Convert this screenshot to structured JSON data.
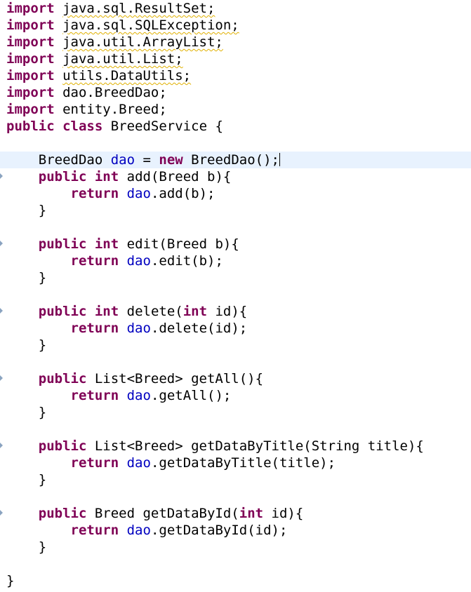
{
  "editor": {
    "language": "java",
    "current_line": 10,
    "lines": [
      {
        "tokens": [
          {
            "t": "import",
            "k": "kw"
          },
          {
            "t": " "
          },
          {
            "t": "java.sql.ResultSet;",
            "sq": true
          }
        ]
      },
      {
        "tokens": [
          {
            "t": "import",
            "k": "kw"
          },
          {
            "t": " "
          },
          {
            "t": "java.sql.SQLException;",
            "sq": true
          }
        ]
      },
      {
        "tokens": [
          {
            "t": "import",
            "k": "kw"
          },
          {
            "t": " "
          },
          {
            "t": "java.util.ArrayList;",
            "sq": true
          }
        ]
      },
      {
        "tokens": [
          {
            "t": "import",
            "k": "kw"
          },
          {
            "t": " "
          },
          {
            "t": "java.util.List;",
            "sq": true
          }
        ]
      },
      {
        "tokens": [
          {
            "t": "import",
            "k": "kw"
          },
          {
            "t": " "
          },
          {
            "t": "utils.DataUtils;",
            "sq": true
          }
        ]
      },
      {
        "tokens": [
          {
            "t": "import",
            "k": "kw"
          },
          {
            "t": " dao.BreedDao;"
          }
        ]
      },
      {
        "tokens": [
          {
            "t": "import",
            "k": "kw"
          },
          {
            "t": " entity.Breed;"
          }
        ]
      },
      {
        "tokens": [
          {
            "t": "public",
            "k": "kw"
          },
          {
            "t": " "
          },
          {
            "t": "class",
            "k": "kw"
          },
          {
            "t": " BreedService {"
          }
        ]
      },
      {
        "tokens": []
      },
      {
        "tokens": [
          {
            "t": "    BreedDao "
          },
          {
            "t": "dao",
            "k": "fld"
          },
          {
            "t": " = "
          },
          {
            "t": "new",
            "k": "kw"
          },
          {
            "t": " BreedDao();"
          }
        ],
        "caret": true
      },
      {
        "tokens": [
          {
            "t": "    "
          },
          {
            "t": "public",
            "k": "kw"
          },
          {
            "t": " "
          },
          {
            "t": "int",
            "k": "kw"
          },
          {
            "t": " add(Breed b){"
          }
        ],
        "fold": true
      },
      {
        "tokens": [
          {
            "t": "        "
          },
          {
            "t": "return",
            "k": "kw"
          },
          {
            "t": " "
          },
          {
            "t": "dao",
            "k": "fld"
          },
          {
            "t": ".add(b);"
          }
        ]
      },
      {
        "tokens": [
          {
            "t": "    }"
          }
        ]
      },
      {
        "tokens": []
      },
      {
        "tokens": [
          {
            "t": "    "
          },
          {
            "t": "public",
            "k": "kw"
          },
          {
            "t": " "
          },
          {
            "t": "int",
            "k": "kw"
          },
          {
            "t": " edit(Breed b){"
          }
        ],
        "fold": true
      },
      {
        "tokens": [
          {
            "t": "        "
          },
          {
            "t": "return",
            "k": "kw"
          },
          {
            "t": " "
          },
          {
            "t": "dao",
            "k": "fld"
          },
          {
            "t": ".edit(b);"
          }
        ]
      },
      {
        "tokens": [
          {
            "t": "    }"
          }
        ]
      },
      {
        "tokens": []
      },
      {
        "tokens": [
          {
            "t": "    "
          },
          {
            "t": "public",
            "k": "kw"
          },
          {
            "t": " "
          },
          {
            "t": "int",
            "k": "kw"
          },
          {
            "t": " delete("
          },
          {
            "t": "int",
            "k": "kw"
          },
          {
            "t": " id){"
          }
        ],
        "fold": true
      },
      {
        "tokens": [
          {
            "t": "        "
          },
          {
            "t": "return",
            "k": "kw"
          },
          {
            "t": " "
          },
          {
            "t": "dao",
            "k": "fld"
          },
          {
            "t": ".delete(id);"
          }
        ]
      },
      {
        "tokens": [
          {
            "t": "    }"
          }
        ]
      },
      {
        "tokens": []
      },
      {
        "tokens": [
          {
            "t": "    "
          },
          {
            "t": "public",
            "k": "kw"
          },
          {
            "t": " List<Breed> getAll(){"
          }
        ],
        "fold": true
      },
      {
        "tokens": [
          {
            "t": "        "
          },
          {
            "t": "return",
            "k": "kw"
          },
          {
            "t": " "
          },
          {
            "t": "dao",
            "k": "fld"
          },
          {
            "t": ".getAll();"
          }
        ]
      },
      {
        "tokens": [
          {
            "t": "    }"
          }
        ]
      },
      {
        "tokens": []
      },
      {
        "tokens": [
          {
            "t": "    "
          },
          {
            "t": "public",
            "k": "kw"
          },
          {
            "t": " List<Breed> getDataByTitle(String title){"
          }
        ],
        "fold": true
      },
      {
        "tokens": [
          {
            "t": "        "
          },
          {
            "t": "return",
            "k": "kw"
          },
          {
            "t": " "
          },
          {
            "t": "dao",
            "k": "fld"
          },
          {
            "t": ".getDataByTitle(title);"
          }
        ]
      },
      {
        "tokens": [
          {
            "t": "    }"
          }
        ]
      },
      {
        "tokens": []
      },
      {
        "tokens": [
          {
            "t": "    "
          },
          {
            "t": "public",
            "k": "kw"
          },
          {
            "t": " Breed getDataById("
          },
          {
            "t": "int",
            "k": "kw"
          },
          {
            "t": " id){"
          }
        ],
        "fold": true
      },
      {
        "tokens": [
          {
            "t": "        "
          },
          {
            "t": "return",
            "k": "kw"
          },
          {
            "t": " "
          },
          {
            "t": "dao",
            "k": "fld"
          },
          {
            "t": ".getDataById(id);"
          }
        ]
      },
      {
        "tokens": [
          {
            "t": "    }"
          }
        ]
      },
      {
        "tokens": []
      },
      {
        "tokens": [
          {
            "t": "}"
          }
        ]
      }
    ]
  },
  "colors": {
    "keyword": "#7f0055",
    "field": "#0000c0",
    "text": "#000000",
    "current_line_highlight": "#e8f2fe",
    "warning_squiggle": "#e0b000",
    "fold_marker": "#8aa3c0"
  }
}
